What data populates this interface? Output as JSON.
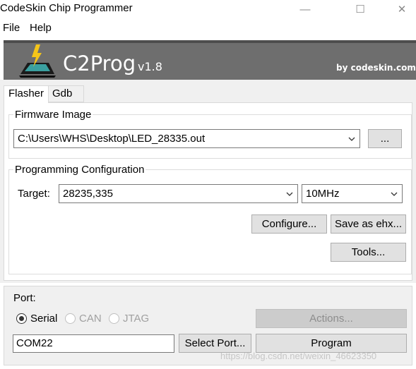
{
  "window": {
    "title": "CodeSkin Chip Programmer",
    "controls": {
      "minimize": "—",
      "maximize": "☐",
      "close": "✕"
    }
  },
  "menu": [
    "File",
    "Help"
  ],
  "banner": {
    "app_name": "C2Prog",
    "version": "v1.8",
    "byline": "by codeskin.com",
    "logo_icon": "lightning-chip-icon"
  },
  "tabs": [
    "Flasher",
    "Gdb"
  ],
  "firmware": {
    "group_label": "Firmware Image",
    "path": "C:\\Users\\WHS\\Desktop\\LED_28335.out",
    "browse_label": "..."
  },
  "programming": {
    "group_label": "Programming Configuration",
    "target_label": "Target:",
    "target_value": "28235,335",
    "clock_value": "10MHz",
    "configure_label": "Configure...",
    "save_ehx_label": "Save as ehx...",
    "tools_label": "Tools..."
  },
  "port": {
    "group_label": "Port:",
    "options": [
      "Serial",
      "CAN",
      "JTAG"
    ],
    "selected": "Serial",
    "value": "COM22",
    "select_port_label": "Select Port...",
    "actions_label": "Actions...",
    "program_label": "Program"
  },
  "watermark": "https://blog.csdn.net/weixin_46623350"
}
